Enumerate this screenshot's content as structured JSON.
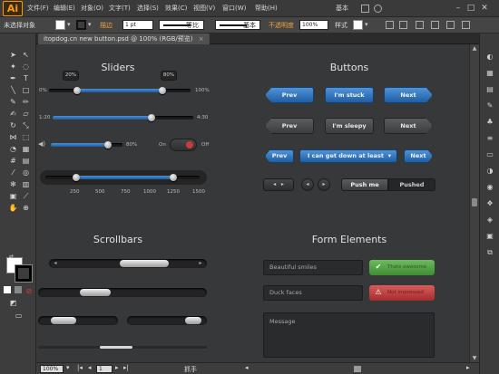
{
  "app": {
    "logo": "Ai"
  },
  "menu": [
    "文件(F)",
    "编辑(E)",
    "对象(O)",
    "文字(T)",
    "选择(S)",
    "效果(C)",
    "视图(V)",
    "窗口(W)",
    "帮助(H)"
  ],
  "workspace": {
    "label": "基本"
  },
  "control_bar": {
    "selection_label": "未选择对象",
    "stroke_label": "描边",
    "stroke_weight": "1 pt",
    "uniform_label": "等比",
    "basic_label": "基本",
    "opacity_label": "不透明度",
    "opacity_value": "100%",
    "style_label": "样式"
  },
  "document_tab": {
    "title": "itopdog.cn new button.psd @ 100% (RGB/预览)",
    "close": "×"
  },
  "canvas": {
    "sliders": {
      "title": "Sliders",
      "bubble_left": "20%",
      "bubble_right": "80%",
      "range_min": "0%",
      "range_max": "100%",
      "range_low": 0.2,
      "range_high": 0.8,
      "time_start": "1:20",
      "time_end": "4:30",
      "time_progress": 0.7,
      "volume_level": "80%",
      "volume_fraction": 0.8,
      "toggle_on": "On",
      "toggle_off": "Off",
      "ticks": [
        "250",
        "500",
        "750",
        "1000",
        "1250",
        "1500"
      ],
      "ticks_low": 0.2,
      "ticks_high": 0.83
    },
    "buttons": {
      "title": "Buttons",
      "row1": [
        "Prev",
        "I'm stuck",
        "Next"
      ],
      "row2": [
        "Prev",
        "I'm sleepy",
        "Next"
      ],
      "row3_prev": "Prev",
      "row3_select": "I can get down at least",
      "row3_next": "Next",
      "push_me": "Push me",
      "pushed": "Pushed"
    },
    "scrollbars": {
      "title": "Scrollbars"
    },
    "form": {
      "title": "Form Elements",
      "field1": "Beautiful smiles",
      "msg_ok": "Thats awesome",
      "field2": "Duck faces",
      "msg_err": "Not impressed",
      "message_placeholder": "Message"
    }
  },
  "status_bar": {
    "zoom": "100%",
    "page": "1",
    "tool": "抓手"
  },
  "colors": {
    "accent": "#2f79c4",
    "success": "#55a946",
    "error": "#c94242",
    "canvas_bg": "#373839"
  }
}
